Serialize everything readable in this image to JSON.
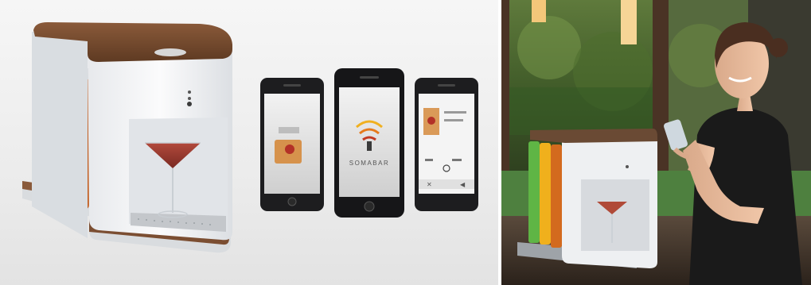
{
  "left_photo": {
    "app_brand": "SOMABAR",
    "phone3_labels": {
      "row1": "",
      "row2": "",
      "btn_left": "",
      "btn_right": ""
    }
  },
  "right_photo": {}
}
